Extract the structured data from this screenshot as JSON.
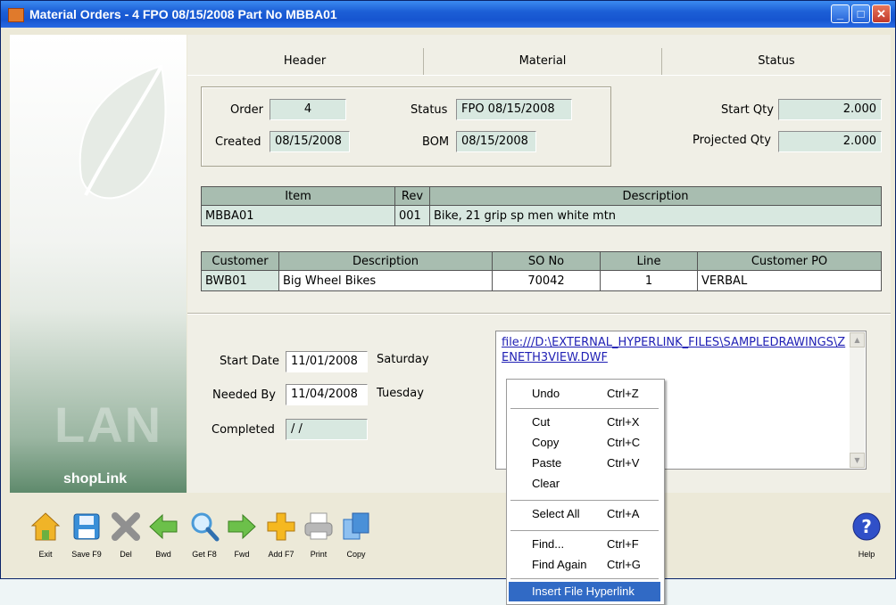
{
  "window": {
    "title": "Material Orders - 4  FPO 08/15/2008  Part No MBBA01",
    "minimize": "_",
    "maximize": "□",
    "close": "✕"
  },
  "branding": {
    "lan": "LAN",
    "shoplink": "shopLink"
  },
  "tabs": [
    {
      "label": "Header"
    },
    {
      "label": "Material"
    },
    {
      "label": "Status"
    }
  ],
  "header": {
    "order_label": "Order",
    "order_value": "4",
    "status_label": "Status",
    "status_value": "FPO 08/15/2008",
    "created_label": "Created",
    "created_value": "08/15/2008",
    "bom_label": "BOM",
    "bom_value": "08/15/2008",
    "start_qty_label": "Start Qty",
    "start_qty_value": "2.000",
    "projected_qty_label": "Projected Qty",
    "projected_qty_value": "2.000"
  },
  "item_table": {
    "headers": [
      "Item",
      "Rev",
      "Description"
    ],
    "row": [
      "MBBA01",
      "001",
      "Bike, 21 grip sp men white mtn"
    ]
  },
  "customer_table": {
    "headers": [
      "Customer",
      "Description",
      "SO No",
      "Line",
      "Customer PO"
    ],
    "row": [
      "BWB01",
      "Big Wheel Bikes",
      "70042",
      "1",
      "VERBAL"
    ]
  },
  "dates": {
    "start_label": "Start Date",
    "start_value": "11/01/2008",
    "start_day": "Saturday",
    "needed_label": "Needed By",
    "needed_value": "11/04/2008",
    "needed_day": "Tuesday",
    "completed_label": "Completed",
    "completed_value": " / /"
  },
  "memo": {
    "text": "file:///D:\\EXTERNAL_HYPERLINK_FILES\\SAMPLEDRAWINGS\\ZENETH3VIEW.DWF"
  },
  "toolbar": [
    {
      "label": "Exit",
      "icon": "home-icon",
      "color": "#f0b428"
    },
    {
      "label": "Save F9",
      "icon": "floppy-disk-icon",
      "color": "#3a8fd8"
    },
    {
      "label": "Del",
      "icon": "delete-x-icon",
      "color": "#909090"
    },
    {
      "label": "Bwd",
      "icon": "arrow-left-icon",
      "color": "#6cc04a"
    },
    {
      "label": "Get F8",
      "icon": "magnifier-icon",
      "color": "#4a9ad8"
    },
    {
      "label": "Fwd",
      "icon": "arrow-right-icon",
      "color": "#6cc04a"
    },
    {
      "label": "Add F7",
      "icon": "plus-icon",
      "color": "#f5b820"
    },
    {
      "label": "Print",
      "icon": "printer-icon",
      "color": "#a8a8a8"
    },
    {
      "label": "Copy",
      "icon": "copy-pages-icon",
      "color": "#4a90d8"
    },
    {
      "label": "Help",
      "icon": "help-question-icon",
      "color": "#3050c8"
    }
  ],
  "context_menu": {
    "items": [
      {
        "label": "Undo",
        "shortcut": "Ctrl+Z"
      },
      {
        "label": "Cut",
        "shortcut": "Ctrl+X"
      },
      {
        "label": "Copy",
        "shortcut": "Ctrl+C"
      },
      {
        "label": "Paste",
        "shortcut": "Ctrl+V"
      },
      {
        "label": "Clear",
        "shortcut": ""
      },
      {
        "label": "Select All",
        "shortcut": "Ctrl+A"
      },
      {
        "label": "Find...",
        "shortcut": "Ctrl+F"
      },
      {
        "label": "Find Again",
        "shortcut": "Ctrl+G"
      },
      {
        "label": "Insert File Hyperlink",
        "shortcut": ""
      }
    ],
    "selected": "Insert File Hyperlink"
  }
}
